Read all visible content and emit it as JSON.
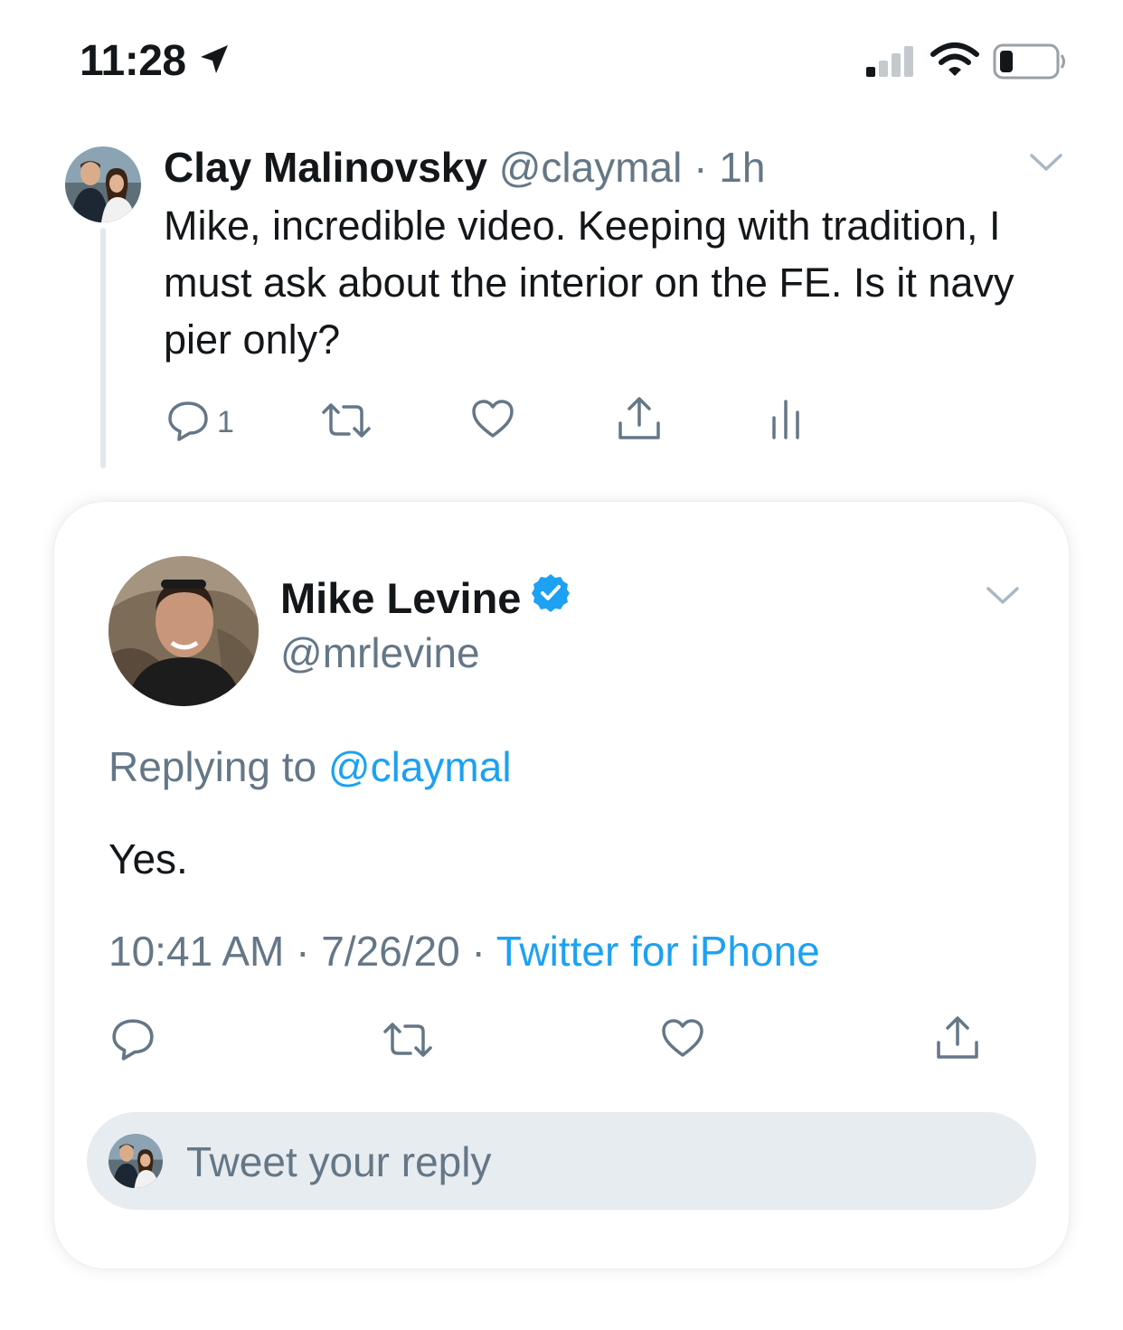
{
  "status_bar": {
    "time": "11:28"
  },
  "parent_tweet": {
    "author_name": "Clay Malinovsky",
    "handle": "@claymal",
    "separator": "·",
    "time": "1h",
    "text": "Mike, incredible video. Keeping with tradition, I must ask about the interior on the FE. Is it navy pier only?",
    "reply_count": "1"
  },
  "main_tweet": {
    "author_name": "Mike Levine",
    "handle": "@mrlevine",
    "replying_prefix": "Replying to",
    "replying_mention": "@claymal",
    "text": "Yes.",
    "time": "10:41 AM",
    "date": "7/26/20",
    "separator": "·",
    "source": "Twitter for iPhone"
  },
  "reply_box": {
    "placeholder": "Tweet your reply"
  },
  "colors": {
    "accent": "#1da1f2",
    "secondary_text": "#657786",
    "verified": "#1da1f2"
  }
}
